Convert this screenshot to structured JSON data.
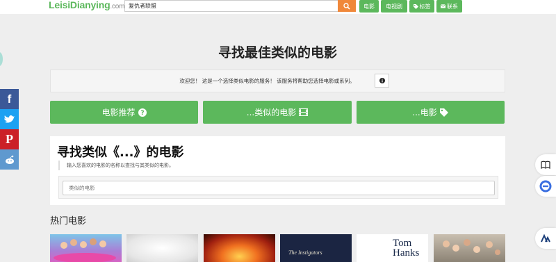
{
  "header": {
    "logo_main": "LeisiDianying",
    "logo_suffix": ".com",
    "search_value": "复仇者联盟",
    "nav": [
      {
        "label": "电影",
        "icon": ""
      },
      {
        "label": "电视剧",
        "icon": ""
      },
      {
        "label": "标签",
        "icon": "tag-icon"
      },
      {
        "label": "联系",
        "icon": "envelope-icon"
      }
    ]
  },
  "main": {
    "title": "寻找最佳类似的电影",
    "welcome_text": "欢迎您！ 这是一个选择类似电影的服务！ 该服务将帮助您选择电影或系列。",
    "buttons": [
      {
        "label": "电影推荐",
        "icon": "question-circle-icon"
      },
      {
        "label": "...类似的电影",
        "icon": "film-icon"
      },
      {
        "label": "...电影",
        "icon": "tag-icon"
      }
    ]
  },
  "search_card": {
    "title": "寻找类似《...》的电影",
    "hint": "输入您喜欢的电影的名称以查找与其类似的电影。",
    "placeholder": "类似的电影"
  },
  "popular": {
    "title": "热门电影",
    "posters": [
      {
        "name": "poster-1",
        "text": ""
      },
      {
        "name": "poster-2",
        "text": ""
      },
      {
        "name": "poster-3",
        "text": ""
      },
      {
        "name": "poster-4",
        "text": "The Instigators"
      },
      {
        "name": "poster-5",
        "text": "Tom Hanks"
      },
      {
        "name": "poster-6",
        "text": ""
      }
    ]
  },
  "social": [
    {
      "name": "facebook",
      "glyph": "f",
      "color": "#3b5998"
    },
    {
      "name": "twitter",
      "glyph": "t",
      "color": "#1da1f2"
    },
    {
      "name": "pinterest",
      "glyph": "P",
      "color": "#cb2027"
    },
    {
      "name": "reddit",
      "glyph": "r",
      "color": "#5f99cf"
    }
  ],
  "colors": {
    "accent": "#5cb85c",
    "search_button": "#f0883a"
  }
}
